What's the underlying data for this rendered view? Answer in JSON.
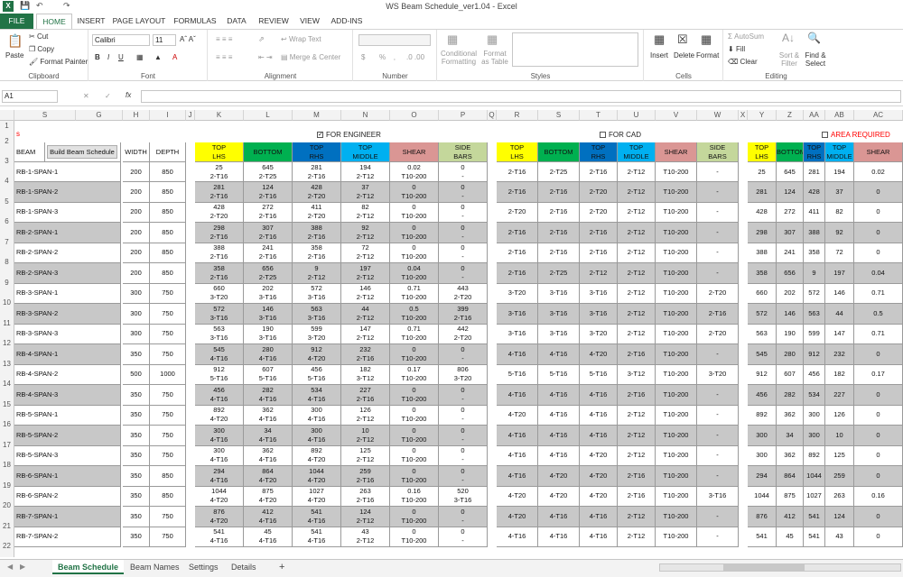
{
  "window": {
    "title": "WS Beam Schedule_ver1.04 - Excel"
  },
  "ribbon_tabs": [
    "FILE",
    "HOME",
    "INSERT",
    "PAGE LAYOUT",
    "FORMULAS",
    "DATA",
    "REVIEW",
    "VIEW",
    "ADD-INS"
  ],
  "clipboard": {
    "paste": "Paste",
    "cut": "Cut",
    "copy": "Copy",
    "format_painter": "Format Painter",
    "label": "Clipboard"
  },
  "font": {
    "name": "Calibri",
    "size": "11",
    "label": "Font"
  },
  "alignment": {
    "wrap": "Wrap Text",
    "merge": "Merge & Center",
    "label": "Alignment"
  },
  "number": {
    "label": "Number",
    "currency": "$",
    "percent": "%"
  },
  "styles": {
    "cond": "Conditional Formatting",
    "table": "Format as Table",
    "label": "Styles"
  },
  "cells": {
    "insert": "Insert",
    "delete": "Delete",
    "format": "Format",
    "label": "Cells"
  },
  "editing": {
    "autosum": "AutoSum",
    "fill": "Fill",
    "clear": "Clear",
    "sort": "Sort & Filter",
    "find": "Find & Select",
    "label": "Editing"
  },
  "name_box": "A1",
  "fx": "fx",
  "columns": [
    "S",
    "G",
    "H",
    "I",
    "J",
    "K",
    "L",
    "M",
    "N",
    "O",
    "P",
    "Q",
    "R",
    "S",
    "T",
    "U",
    "V",
    "W",
    "X",
    "Y",
    "Z",
    "AA",
    "AB",
    "AC"
  ],
  "rows": [
    "1",
    "2",
    "3",
    "4",
    "5",
    "6",
    "7",
    "8",
    "9",
    "10",
    "11",
    "12",
    "13",
    "14",
    "15",
    "16",
    "17",
    "18",
    "19",
    "20",
    "21",
    "22"
  ],
  "row1_corner": "s",
  "checkboxes": {
    "engineer": "FOR ENGINEER",
    "cad": "FOR CAD",
    "area": "AREA REQUIRED"
  },
  "header": {
    "beam": "BEAM",
    "build": "Build Beam Schedule",
    "width": "WIDTH",
    "depth": "DEPTH",
    "eng": [
      [
        "TOP",
        "LHS"
      ],
      [
        "BOTTOM",
        ""
      ],
      [
        "TOP",
        "RHS"
      ],
      [
        "TOP",
        "MIDDLE"
      ],
      [
        "SHEAR",
        ""
      ],
      [
        "SIDE",
        "BARS"
      ]
    ],
    "cad": [
      [
        "TOP",
        "LHS"
      ],
      [
        "BOTTOM",
        ""
      ],
      [
        "TOP",
        "RHS"
      ],
      [
        "TOP",
        "MIDDLE"
      ],
      [
        "SHEAR",
        ""
      ],
      [
        "SIDE",
        "BARS"
      ]
    ],
    "area": [
      [
        "TOP",
        "LHS"
      ],
      [
        "BOTTOM",
        ""
      ],
      [
        "TOP",
        "RHS"
      ],
      [
        "TOP",
        "MIDDLE"
      ],
      [
        "SHEAR",
        ""
      ]
    ]
  },
  "colors": {
    "yellow": "#ffff00",
    "green": "#00b050",
    "blue": "#0070c0",
    "cyan": "#00b0f0",
    "pink": "#da9694",
    "sage": "#c4d79b",
    "excel_green": "#217346",
    "red": "#ff0000"
  },
  "beams": [
    {
      "name": "RB-1-SPAN-1",
      "w": "200",
      "d": "850",
      "eng": [
        [
          "25",
          "2-T16"
        ],
        [
          "645",
          "2-T25"
        ],
        [
          "281",
          "2-T16"
        ],
        [
          "194",
          "2-T12"
        ],
        [
          "0.02",
          "T10-200"
        ],
        [
          "0",
          "-"
        ]
      ],
      "cad": [
        "2-T16",
        "2-T25",
        "2-T16",
        "2-T12",
        "T10-200",
        "-"
      ],
      "area": [
        "25",
        "645",
        "281",
        "194",
        "0.02"
      ]
    },
    {
      "name": "RB-1-SPAN-2",
      "w": "200",
      "d": "850",
      "eng": [
        [
          "281",
          "2-T16"
        ],
        [
          "124",
          "2-T16"
        ],
        [
          "428",
          "2-T20"
        ],
        [
          "37",
          "2-T12"
        ],
        [
          "0",
          "T10-200"
        ],
        [
          "0",
          "-"
        ]
      ],
      "cad": [
        "2-T16",
        "2-T16",
        "2-T20",
        "2-T12",
        "T10-200",
        "-"
      ],
      "area": [
        "281",
        "124",
        "428",
        "37",
        "0"
      ]
    },
    {
      "name": "RB-1-SPAN-3",
      "w": "200",
      "d": "850",
      "eng": [
        [
          "428",
          "2-T20"
        ],
        [
          "272",
          "2-T16"
        ],
        [
          "411",
          "2-T20"
        ],
        [
          "82",
          "2-T12"
        ],
        [
          "0",
          "T10-200"
        ],
        [
          "0",
          "-"
        ]
      ],
      "cad": [
        "2-T20",
        "2-T16",
        "2-T20",
        "2-T12",
        "T10-200",
        "-"
      ],
      "area": [
        "428",
        "272",
        "411",
        "82",
        "0"
      ]
    },
    {
      "name": "RB-2-SPAN-1",
      "w": "200",
      "d": "850",
      "eng": [
        [
          "298",
          "2-T16"
        ],
        [
          "307",
          "2-T16"
        ],
        [
          "388",
          "2-T16"
        ],
        [
          "92",
          "2-T12"
        ],
        [
          "0",
          "T10-200"
        ],
        [
          "0",
          "-"
        ]
      ],
      "cad": [
        "2-T16",
        "2-T16",
        "2-T16",
        "2-T12",
        "T10-200",
        "-"
      ],
      "area": [
        "298",
        "307",
        "388",
        "92",
        "0"
      ]
    },
    {
      "name": "RB-2-SPAN-2",
      "w": "200",
      "d": "850",
      "eng": [
        [
          "388",
          "2-T16"
        ],
        [
          "241",
          "2-T16"
        ],
        [
          "358",
          "2-T16"
        ],
        [
          "72",
          "2-T12"
        ],
        [
          "0",
          "T10-200"
        ],
        [
          "0",
          "-"
        ]
      ],
      "cad": [
        "2-T16",
        "2-T16",
        "2-T16",
        "2-T12",
        "T10-200",
        "-"
      ],
      "area": [
        "388",
        "241",
        "358",
        "72",
        "0"
      ]
    },
    {
      "name": "RB-2-SPAN-3",
      "w": "200",
      "d": "850",
      "eng": [
        [
          "358",
          "2-T16"
        ],
        [
          "656",
          "2-T25"
        ],
        [
          "9",
          "2-T12"
        ],
        [
          "197",
          "2-T12"
        ],
        [
          "0.04",
          "T10-200"
        ],
        [
          "0",
          "-"
        ]
      ],
      "cad": [
        "2-T16",
        "2-T25",
        "2-T12",
        "2-T12",
        "T10-200",
        "-"
      ],
      "area": [
        "358",
        "656",
        "9",
        "197",
        "0.04"
      ]
    },
    {
      "name": "RB-3-SPAN-1",
      "w": "300",
      "d": "750",
      "eng": [
        [
          "660",
          "3-T20"
        ],
        [
          "202",
          "3-T16"
        ],
        [
          "572",
          "3-T16"
        ],
        [
          "146",
          "2-T12"
        ],
        [
          "0.71",
          "T10-200"
        ],
        [
          "443",
          "2-T20"
        ]
      ],
      "cad": [
        "3-T20",
        "3-T16",
        "3-T16",
        "2-T12",
        "T10-200",
        "2-T20"
      ],
      "area": [
        "660",
        "202",
        "572",
        "146",
        "0.71"
      ]
    },
    {
      "name": "RB-3-SPAN-2",
      "w": "300",
      "d": "750",
      "eng": [
        [
          "572",
          "3-T16"
        ],
        [
          "146",
          "3-T16"
        ],
        [
          "563",
          "3-T16"
        ],
        [
          "44",
          "2-T12"
        ],
        [
          "0.5",
          "T10-200"
        ],
        [
          "399",
          "2-T16"
        ]
      ],
      "cad": [
        "3-T16",
        "3-T16",
        "3-T16",
        "2-T12",
        "T10-200",
        "2-T16"
      ],
      "area": [
        "572",
        "146",
        "563",
        "44",
        "0.5"
      ]
    },
    {
      "name": "RB-3-SPAN-3",
      "w": "300",
      "d": "750",
      "eng": [
        [
          "563",
          "3-T16"
        ],
        [
          "190",
          "3-T16"
        ],
        [
          "599",
          "3-T20"
        ],
        [
          "147",
          "2-T12"
        ],
        [
          "0.71",
          "T10-200"
        ],
        [
          "442",
          "2-T20"
        ]
      ],
      "cad": [
        "3-T16",
        "3-T16",
        "3-T20",
        "2-T12",
        "T10-200",
        "2-T20"
      ],
      "area": [
        "563",
        "190",
        "599",
        "147",
        "0.71"
      ]
    },
    {
      "name": "RB-4-SPAN-1",
      "w": "350",
      "d": "750",
      "eng": [
        [
          "545",
          "4-T16"
        ],
        [
          "280",
          "4-T16"
        ],
        [
          "912",
          "4-T20"
        ],
        [
          "232",
          "2-T16"
        ],
        [
          "0",
          "T10-200"
        ],
        [
          "0",
          "-"
        ]
      ],
      "cad": [
        "4-T16",
        "4-T16",
        "4-T20",
        "2-T16",
        "T10-200",
        "-"
      ],
      "area": [
        "545",
        "280",
        "912",
        "232",
        "0"
      ]
    },
    {
      "name": "RB-4-SPAN-2",
      "w": "500",
      "d": "1000",
      "eng": [
        [
          "912",
          "5-T16"
        ],
        [
          "607",
          "5-T16"
        ],
        [
          "456",
          "5-T16"
        ],
        [
          "182",
          "3-T12"
        ],
        [
          "0.17",
          "T10-200"
        ],
        [
          "806",
          "3-T20"
        ]
      ],
      "cad": [
        "5-T16",
        "5-T16",
        "5-T16",
        "3-T12",
        "T10-200",
        "3-T20"
      ],
      "area": [
        "912",
        "607",
        "456",
        "182",
        "0.17"
      ]
    },
    {
      "name": "RB-4-SPAN-3",
      "w": "350",
      "d": "750",
      "eng": [
        [
          "456",
          "4-T16"
        ],
        [
          "282",
          "4-T16"
        ],
        [
          "534",
          "4-T16"
        ],
        [
          "227",
          "2-T16"
        ],
        [
          "0",
          "T10-200"
        ],
        [
          "0",
          "-"
        ]
      ],
      "cad": [
        "4-T16",
        "4-T16",
        "4-T16",
        "2-T16",
        "T10-200",
        "-"
      ],
      "area": [
        "456",
        "282",
        "534",
        "227",
        "0"
      ]
    },
    {
      "name": "RB-5-SPAN-1",
      "w": "350",
      "d": "750",
      "eng": [
        [
          "892",
          "4-T20"
        ],
        [
          "362",
          "4-T16"
        ],
        [
          "300",
          "4-T16"
        ],
        [
          "126",
          "2-T12"
        ],
        [
          "0",
          "T10-200"
        ],
        [
          "0",
          "-"
        ]
      ],
      "cad": [
        "4-T20",
        "4-T16",
        "4-T16",
        "2-T12",
        "T10-200",
        "-"
      ],
      "area": [
        "892",
        "362",
        "300",
        "126",
        "0"
      ]
    },
    {
      "name": "RB-5-SPAN-2",
      "w": "350",
      "d": "750",
      "eng": [
        [
          "300",
          "4-T16"
        ],
        [
          "34",
          "4-T16"
        ],
        [
          "300",
          "4-T16"
        ],
        [
          "10",
          "2-T12"
        ],
        [
          "0",
          "T10-200"
        ],
        [
          "0",
          "-"
        ]
      ],
      "cad": [
        "4-T16",
        "4-T16",
        "4-T16",
        "2-T12",
        "T10-200",
        "-"
      ],
      "area": [
        "300",
        "34",
        "300",
        "10",
        "0"
      ]
    },
    {
      "name": "RB-5-SPAN-3",
      "w": "350",
      "d": "750",
      "eng": [
        [
          "300",
          "4-T16"
        ],
        [
          "362",
          "4-T16"
        ],
        [
          "892",
          "4-T20"
        ],
        [
          "125",
          "2-T12"
        ],
        [
          "0",
          "T10-200"
        ],
        [
          "0",
          "-"
        ]
      ],
      "cad": [
        "4-T16",
        "4-T16",
        "4-T20",
        "2-T12",
        "T10-200",
        "-"
      ],
      "area": [
        "300",
        "362",
        "892",
        "125",
        "0"
      ]
    },
    {
      "name": "RB-6-SPAN-1",
      "w": "350",
      "d": "850",
      "eng": [
        [
          "294",
          "4-T16"
        ],
        [
          "864",
          "4-T20"
        ],
        [
          "1044",
          "4-T20"
        ],
        [
          "259",
          "2-T16"
        ],
        [
          "0",
          "T10-200"
        ],
        [
          "0",
          "-"
        ]
      ],
      "cad": [
        "4-T16",
        "4-T20",
        "4-T20",
        "2-T16",
        "T10-200",
        "-"
      ],
      "area": [
        "294",
        "864",
        "1044",
        "259",
        "0"
      ]
    },
    {
      "name": "RB-6-SPAN-2",
      "w": "350",
      "d": "850",
      "eng": [
        [
          "1044",
          "4-T20"
        ],
        [
          "875",
          "4-T20"
        ],
        [
          "1027",
          "4-T20"
        ],
        [
          "263",
          "2-T16"
        ],
        [
          "0.16",
          "T10-200"
        ],
        [
          "520",
          "3-T16"
        ]
      ],
      "cad": [
        "4-T20",
        "4-T20",
        "4-T20",
        "2-T16",
        "T10-200",
        "3-T16"
      ],
      "area": [
        "1044",
        "875",
        "1027",
        "263",
        "0.16"
      ]
    },
    {
      "name": "RB-7-SPAN-1",
      "w": "350",
      "d": "750",
      "eng": [
        [
          "876",
          "4-T20"
        ],
        [
          "412",
          "4-T16"
        ],
        [
          "541",
          "4-T16"
        ],
        [
          "124",
          "2-T12"
        ],
        [
          "0",
          "T10-200"
        ],
        [
          "0",
          "-"
        ]
      ],
      "cad": [
        "4-T20",
        "4-T16",
        "4-T16",
        "2-T12",
        "T10-200",
        "-"
      ],
      "area": [
        "876",
        "412",
        "541",
        "124",
        "0"
      ]
    },
    {
      "name": "RB-7-SPAN-2",
      "w": "350",
      "d": "750",
      "eng": [
        [
          "541",
          "4-T16"
        ],
        [
          "45",
          "4-T16"
        ],
        [
          "541",
          "4-T16"
        ],
        [
          "43",
          "2-T12"
        ],
        [
          "0",
          "T10-200"
        ],
        [
          "0",
          "-"
        ]
      ],
      "cad": [
        "4-T16",
        "4-T16",
        "4-T16",
        "2-T12",
        "T10-200",
        "-"
      ],
      "area": [
        "541",
        "45",
        "541",
        "43",
        "0"
      ]
    }
  ],
  "sheet_tabs": [
    "Beam Schedule",
    "Beam Names",
    "Settings",
    "Details"
  ],
  "add_sheet": "+"
}
